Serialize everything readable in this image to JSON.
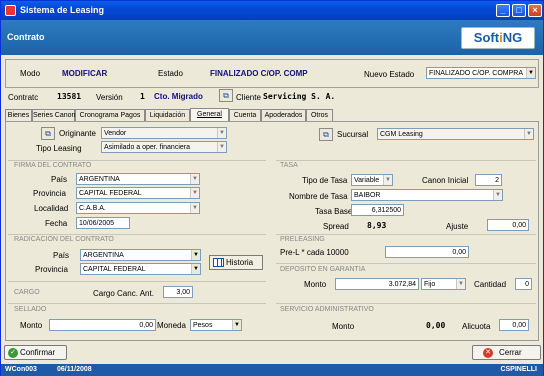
{
  "window": {
    "title": "Sistema de Leasing"
  },
  "header": {
    "title": "Contrato",
    "logo_main": "Soft",
    "logo_accent": "i",
    "logo_end": "NG"
  },
  "statebar": {
    "modo_label": "Modo",
    "modo_value": "MODIFICAR",
    "estado_label": "Estado",
    "estado_value": "FINALIZADO C/OP. COMP",
    "nuevo_estado_label": "Nuevo Estado",
    "nuevo_estado_value": "FINALIZADO C/OP. COMPRA"
  },
  "contract": {
    "contrato_label": "Contratc",
    "contrato_value": "13581",
    "version_label": "Versión",
    "version_value": "1",
    "cto_value": "Cto. Migrado",
    "cliente_label": "Cliente",
    "cliente_value": "Servicing S. A."
  },
  "tabs": [
    "Bienes",
    "Series Canon",
    "Cronograma Pagos",
    "Liquidación",
    "General",
    "Cuenta",
    "Apoderados",
    "Otros"
  ],
  "general": {
    "originante_label": "Originante",
    "originante_value": "Vendor",
    "tipo_leasing_label": "Tipo Leasing",
    "tipo_leasing_value": "Asimilado a oper. financiera",
    "sucursal_label": "Sucursal",
    "sucursal_value": "CGM Leasing"
  },
  "firma": {
    "title": "FIRMA DEL CONTRATO",
    "pais_label": "País",
    "pais_value": "ARGENTINA",
    "provincia_label": "Provincia",
    "provincia_value": "CAPITAL FEDERAL",
    "localidad_label": "Localidad",
    "localidad_value": "C.A.B.A.",
    "fecha_label": "Fecha",
    "fecha_value": "10/06/2005"
  },
  "radicacion": {
    "title": "RADICACIÓN DEL CONTRATO",
    "pais_label": "País",
    "pais_value": "ARGENTINA",
    "provincia_label": "Provincia",
    "provincia_value": "CAPITAL FEDERAL",
    "historia_label": "Historia"
  },
  "cargo": {
    "title": "CARGO",
    "label": "Cargo Canc. Ant.",
    "value": "3,00"
  },
  "sellado": {
    "title": "SELLADO",
    "monto_label": "Monto",
    "monto_value": "0,00",
    "moneda_label": "Moneda",
    "moneda_value": "Pesos"
  },
  "tasa": {
    "title": "TASA",
    "tipo_label": "Tipo de Tasa",
    "tipo_value": "Variable",
    "canon_label": "Canon Inicial",
    "canon_value": "2",
    "nombre_label": "Nombre de Tasa",
    "nombre_value": "BAIBOR",
    "base_label": "Tasa Base",
    "base_value": "6,312500",
    "spread_label": "Spread",
    "spread_value": "8,93",
    "ajuste_label": "Ajuste",
    "ajuste_value": "0,00"
  },
  "preleasing": {
    "title": "PRELEASING",
    "label": "Pre-L * cada 10000",
    "value": "0,00"
  },
  "deposito": {
    "title": "DEPOSITO EN GARANTIA",
    "monto_label": "Monto",
    "monto_value": "3.072,84",
    "tipo_value": "Fijo",
    "cantidad_label": "Cantidad",
    "cantidad_value": "0"
  },
  "servicio": {
    "title": "SERVICIO ADMINISTRATIVO",
    "monto_label": "Monto",
    "monto_value": "0,00",
    "alicuota_label": "Alicuota",
    "alicuota_value": "0,00"
  },
  "buttons": {
    "confirmar": "Confirmar",
    "cerrar": "Cerrar"
  },
  "status": {
    "user_code": "WCon003",
    "date": "06/11/2008",
    "user": "CSPINELLI"
  },
  "colors": {
    "titlebar": "#0A5FE8",
    "header": "#2E7BC0",
    "status": "#1F5AA8",
    "field_label_blue": "#10108A"
  }
}
